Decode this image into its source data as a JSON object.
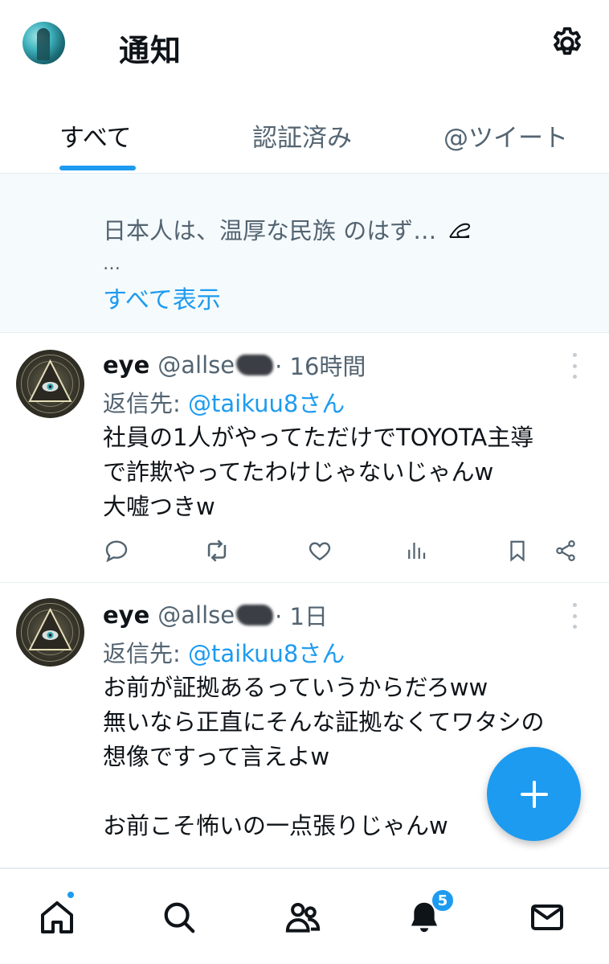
{
  "header": {
    "title": "通知",
    "avatar_icon": "user-avatar",
    "settings_icon": "gear-icon"
  },
  "tabs": [
    {
      "label": "すべて",
      "active": true
    },
    {
      "label": "認証済み",
      "active": false
    },
    {
      "label": "@ツイート",
      "active": false
    }
  ],
  "summary": {
    "text": "日本人は、温厚な民族 のはず…",
    "ellipsis": "…",
    "link": "すべて表示"
  },
  "tweets": [
    {
      "name": "eye",
      "handle": "@allse",
      "time": "· 16時間",
      "reply_prefix": "返信先: ",
      "reply_to": "@taikuu8さん",
      "body": "社員の1人がやってただけでTOYOTA主導\nで詐欺やってたわけじゃないじゃんw\n大嘘つきw"
    },
    {
      "name": "eye",
      "handle": "@allse",
      "time": "· 1日",
      "reply_prefix": "返信先: ",
      "reply_to": "@taikuu8さん",
      "body": "お前が証拠あるっていうからだろww\n無いなら正直にそんな証拠なくてワタシの\n想像ですって言えよw\n\nお前こそ怖いの一点張りじゃんw"
    }
  ],
  "tweet_actions": [
    "reply-icon",
    "retweet-icon",
    "like-icon",
    "views-icon",
    "bookmark-icon",
    "share-icon"
  ],
  "fab": {
    "icon": "plus-icon"
  },
  "bottom_nav": {
    "items": [
      "home-icon",
      "search-icon",
      "communities-icon",
      "notifications-icon",
      "messages-icon"
    ],
    "notification_badge": "5"
  },
  "colors": {
    "accent": "#1d9bf0",
    "text_primary": "#0f1419",
    "text_secondary": "#536471"
  }
}
